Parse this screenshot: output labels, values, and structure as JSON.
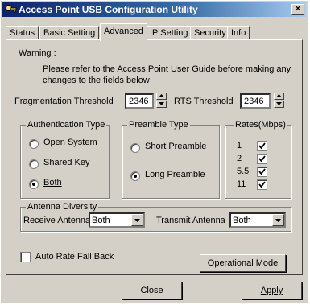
{
  "window": {
    "title": "Access Point USB Configuration Utility",
    "close_glyph": "×",
    "app_icon": "key-icon"
  },
  "tabs": [
    {
      "label": "Status"
    },
    {
      "label": "Basic Setting"
    },
    {
      "label": "Advanced",
      "active": true
    },
    {
      "label": "IP Setting"
    },
    {
      "label": "Security"
    },
    {
      "label": "Info"
    }
  ],
  "warning": {
    "heading": "Warning :",
    "line1": "Please refer to the Access Point User Guide before making any",
    "line2": "changes to the fields below"
  },
  "thresholds": {
    "fragmentation_label": "Fragmentation Threshold",
    "fragmentation_value": "2346",
    "rts_label": "RTS Threshold",
    "rts_value": "2346"
  },
  "authentication": {
    "title": "Authentication Type",
    "options": [
      "Open System",
      "Shared Key",
      "Both"
    ],
    "selected": "Both"
  },
  "preamble": {
    "title": "Preamble Type",
    "options": [
      "Short Preamble",
      "Long Preamble"
    ],
    "selected": "Long Preamble"
  },
  "rates": {
    "title": "Rates(Mbps)",
    "items": [
      {
        "label": "1",
        "checked": true
      },
      {
        "label": "2",
        "checked": true
      },
      {
        "label": "5.5",
        "checked": true
      },
      {
        "label": "11",
        "checked": true
      }
    ]
  },
  "antenna": {
    "title": "Antenna Diversity",
    "receive_label": "Receive Antenna",
    "receive_value": "Both",
    "transmit_label": "Transmit Antenna",
    "transmit_value": "Both"
  },
  "auto_rate": {
    "label": "Auto Rate Fall Back",
    "checked": false
  },
  "buttons": {
    "operational_mode": "Operational Mode",
    "close": "Close",
    "apply": "Apply"
  }
}
